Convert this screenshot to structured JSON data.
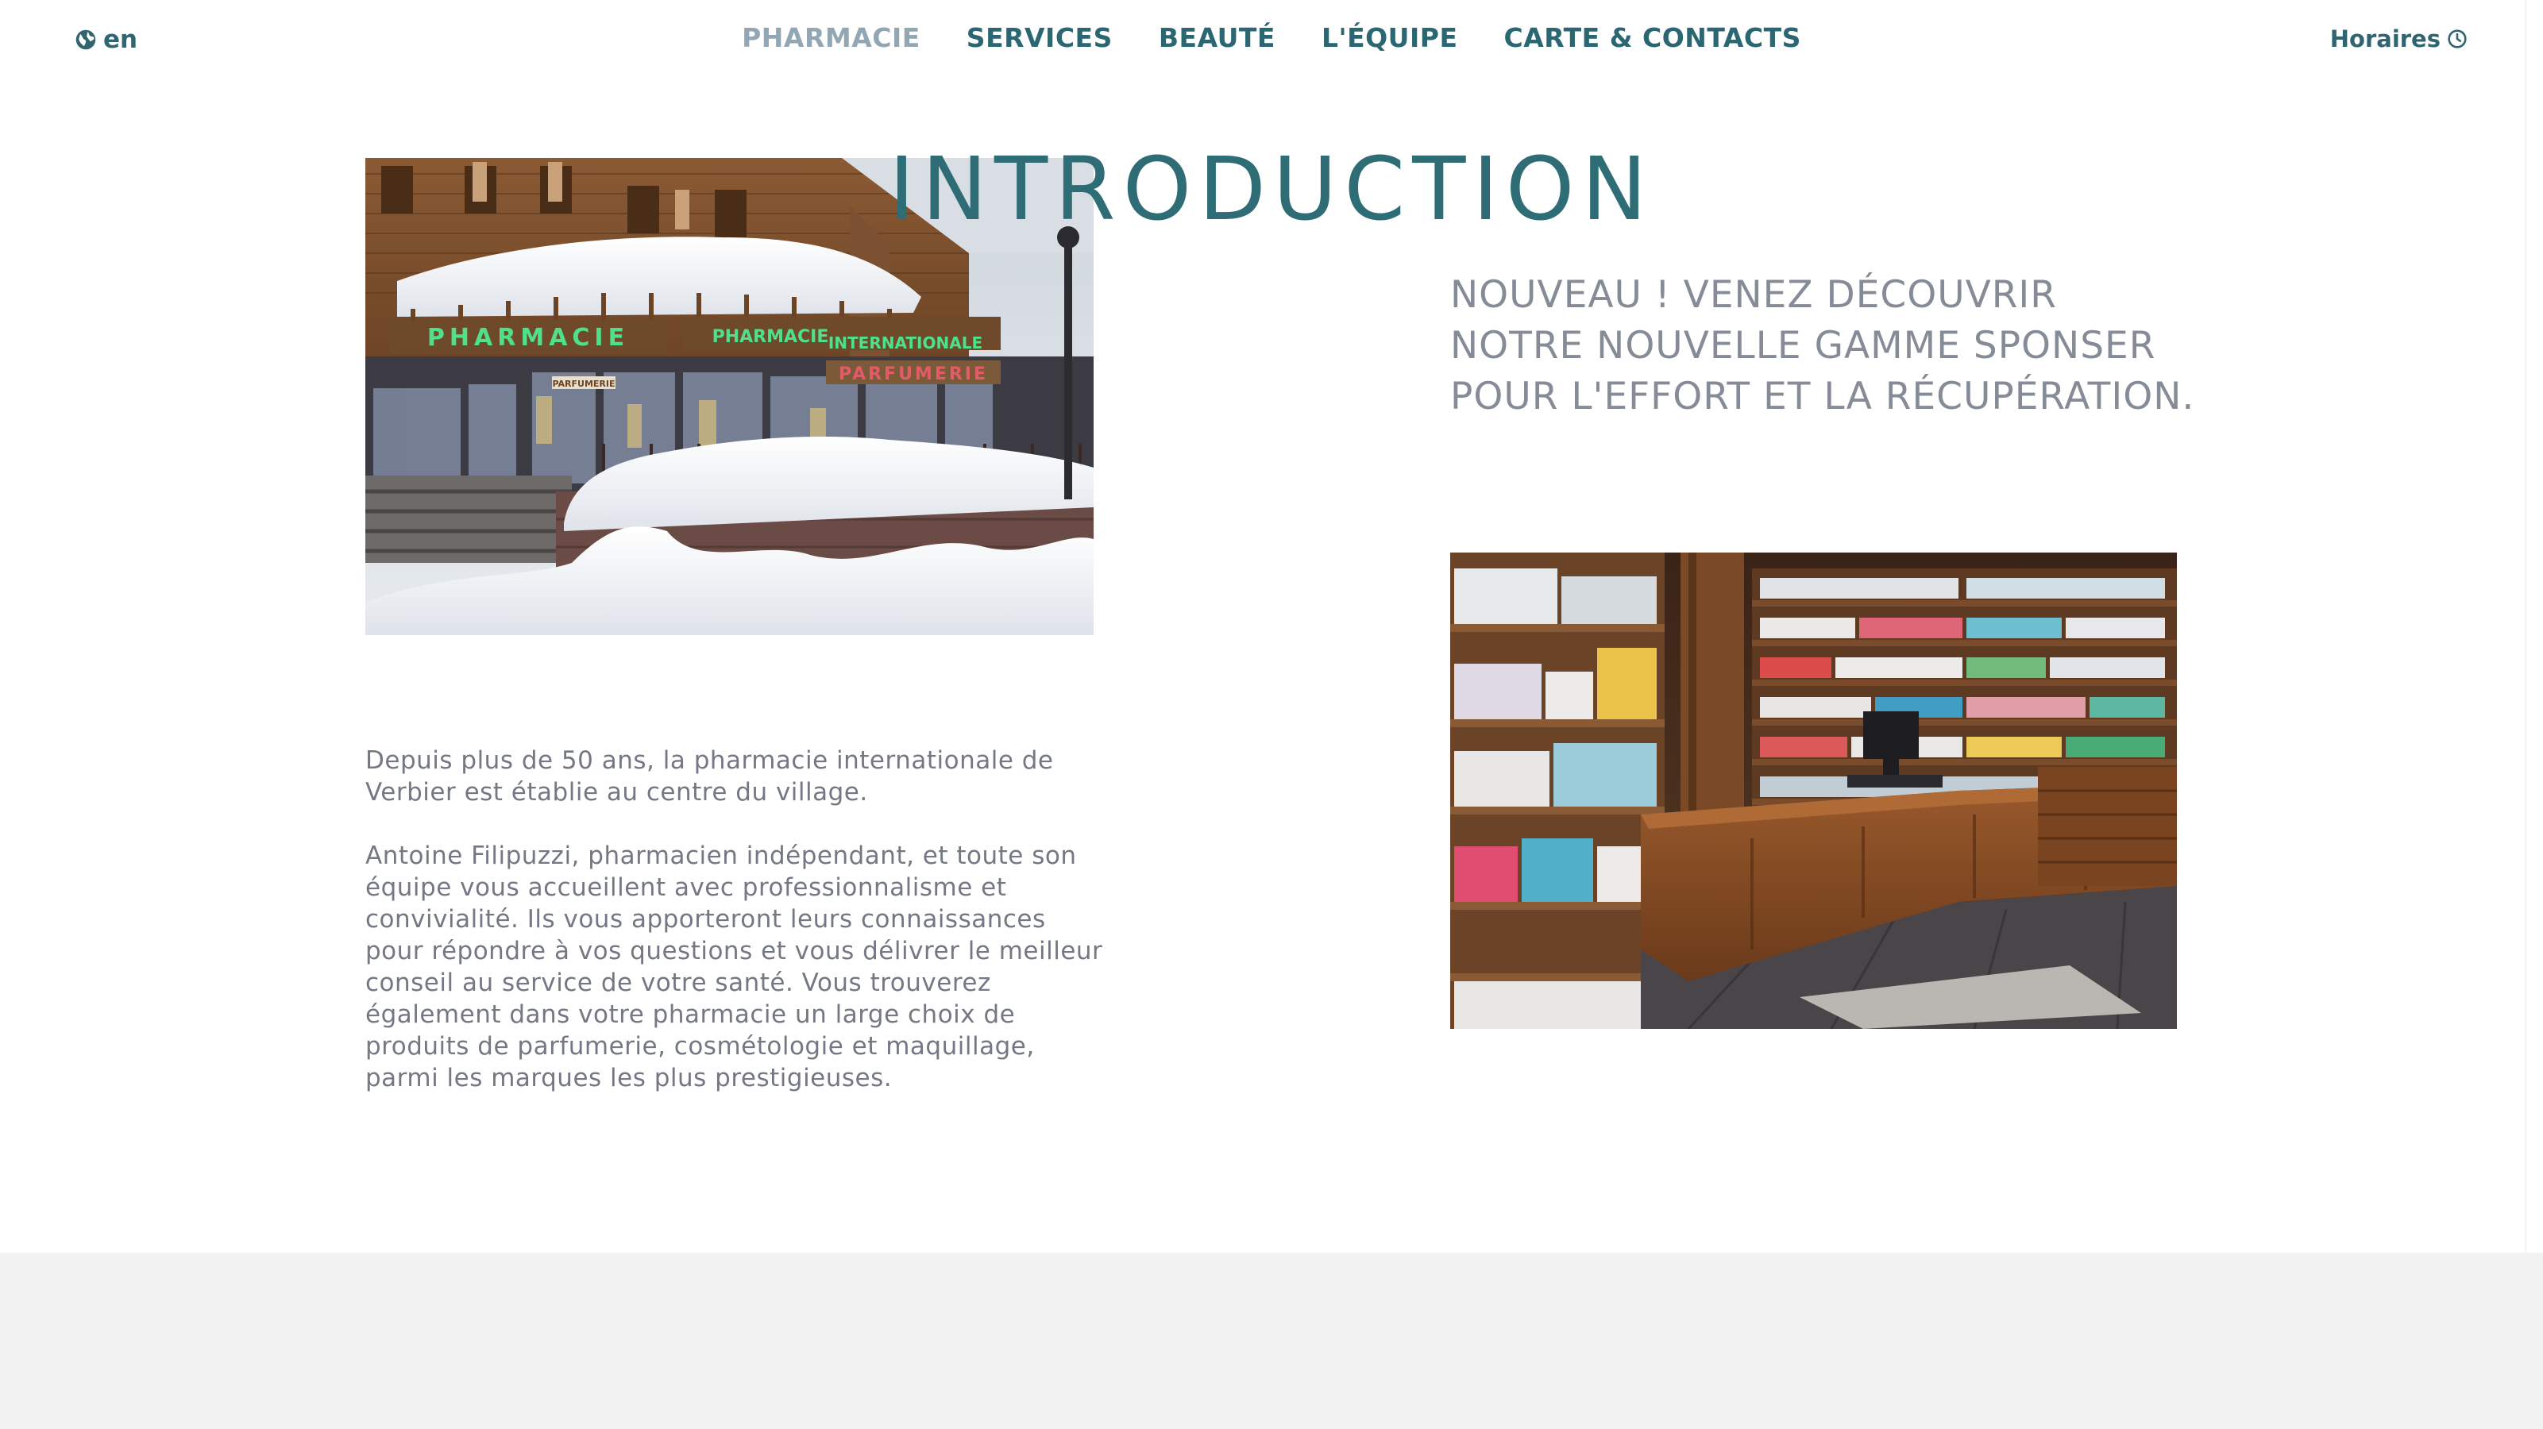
{
  "header": {
    "language": "en",
    "nav": [
      {
        "label": "PHARMACIE",
        "active": true
      },
      {
        "label": "SERVICES",
        "active": false
      },
      {
        "label": "BEAUTÉ",
        "active": false
      },
      {
        "label": "L'ÉQUIPE",
        "active": false
      },
      {
        "label": "CARTE & CONTACTS",
        "active": false
      }
    ],
    "hours_label": "Horaires",
    "icons": {
      "language": "globe-icon",
      "hours": "clock-icon"
    }
  },
  "intro": {
    "title": "INTRODUCTION",
    "headline": "NOUVEAU ! VENEZ DÉCOUVRIR NOTRE NOUVELLE GAMME SPONSER POUR L'EFFORT ET LA RÉCUPÉRATION.",
    "paragraphs": [
      "Depuis plus de 50 ans, la pharmacie internationale de Verbier est établie au centre du village.",
      "Antoine Filipuzzi, pharmacien indépendant, et toute son équipe vous accueillent avec professionnalisme et convivialité. Ils vous apporteront leurs connaissances pour répondre à vos questions et vous délivrer le meilleur conseil au service de votre santé. Vous trouverez également dans votre pharmacie un large choix de produits de parfumerie, cosmétologie et maquillage, parmi les marques les plus prestigieuses."
    ]
  },
  "storefront_photo": {
    "signs": [
      "PHARMACIE",
      "PHARMACIE",
      "INTERNATIONALE",
      "PARFUMERIE",
      "PARFUMERIE"
    ]
  },
  "colors": {
    "nav": "#2b6772",
    "nav_active": "#93a6b4",
    "title": "#2e6c76",
    "headline": "#858b97",
    "body_text": "#737884",
    "footer": "#f2f2f2"
  }
}
